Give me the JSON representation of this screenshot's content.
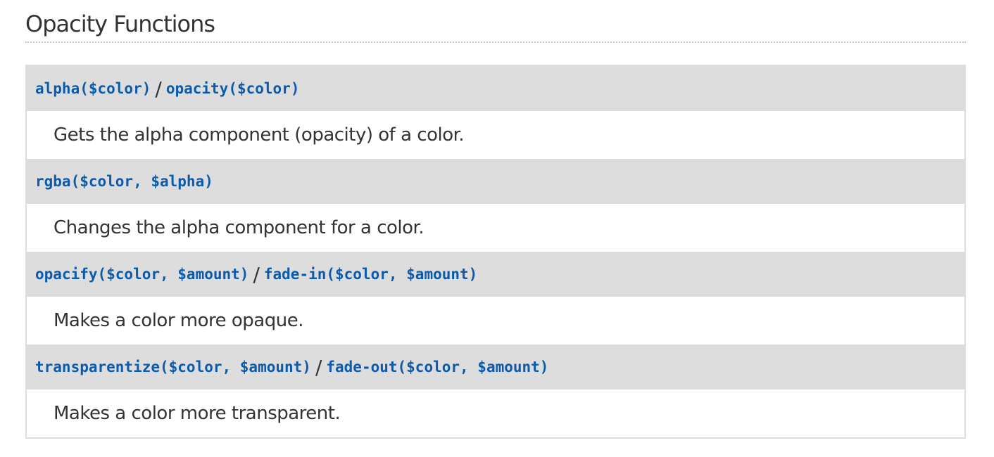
{
  "section": {
    "title": "Opacity Functions"
  },
  "functions": [
    {
      "signatures": [
        "alpha($color)",
        "opacity($color)"
      ],
      "separator": "/",
      "description": "Gets the alpha component (opacity) of a color."
    },
    {
      "signatures": [
        "rgba($color, $alpha)"
      ],
      "description": "Changes the alpha component for a color."
    },
    {
      "signatures": [
        "opacify($color, $amount)",
        "fade-in($color, $amount)"
      ],
      "separator": "/",
      "description": "Makes a color more opaque."
    },
    {
      "signatures": [
        "transparentize($color, $amount)",
        "fade-out($color, $amount)"
      ],
      "separator": "/",
      "description": "Makes a color more transparent."
    }
  ],
  "colors": {
    "signature_text": "#0b5bac",
    "signature_background": "#dddddd",
    "body_text": "#333333"
  }
}
